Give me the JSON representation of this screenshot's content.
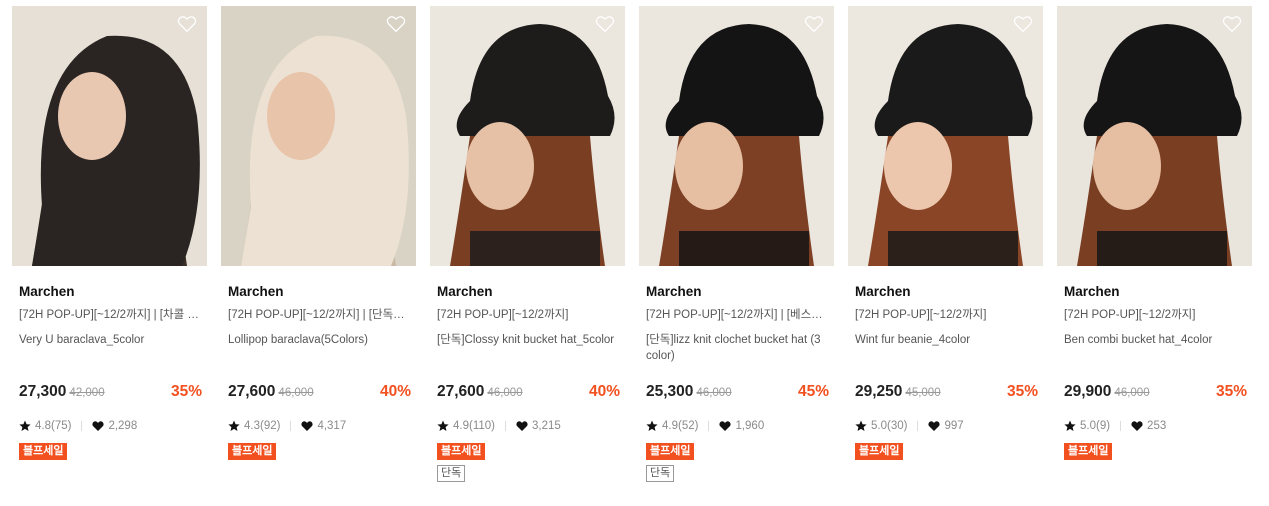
{
  "products": [
    {
      "brand": "Marchen",
      "promo": "[72H POP-UP][~12/2까지] | [차콜 단...",
      "name": "Very U baraclava_5color",
      "price": "27,300",
      "original": "42,000",
      "discount": "35%",
      "rating": "4.8(75)",
      "likes": "2,298",
      "badge": "블프세일",
      "extra_badge": "",
      "img": {
        "bg": "#e6e0d6",
        "hood": "#2a2522",
        "face": "#e9c8b2",
        "hair": "#3a2d26"
      }
    },
    {
      "brand": "Marchen",
      "promo": "[72H POP-UP][~12/2까지] | [단독뉴...",
      "name": "Lollipop baraclava(5Colors)",
      "price": "27,600",
      "original": "46,000",
      "discount": "40%",
      "rating": "4.3(92)",
      "likes": "4,317",
      "badge": "블프세일",
      "extra_badge": "",
      "img": {
        "bg": "#d9d3c6",
        "hood": "#ece1d2",
        "face": "#e8c4ab",
        "hair": "#c9b9a4"
      }
    },
    {
      "brand": "Marchen",
      "promo": "[72H POP-UP][~12/2까지]",
      "name": "[단독]Clossy knit bucket hat_5color",
      "price": "27,600",
      "original": "46,000",
      "discount": "40%",
      "rating": "4.9(110)",
      "likes": "3,215",
      "badge": "블프세일",
      "extra_badge": "단독",
      "img": {
        "bg": "#ebe6de",
        "hood": "#1e1c1b",
        "face": "#e7c1a6",
        "hair": "#7a3e22"
      }
    },
    {
      "brand": "Marchen",
      "promo": "[72H POP-UP][~12/2까지] | [베스트...",
      "name": "[단독]lizz knit clochet bucket hat (3 color)",
      "price": "25,300",
      "original": "46,000",
      "discount": "45%",
      "rating": "4.9(52)",
      "likes": "1,960",
      "badge": "블프세일",
      "extra_badge": "단독",
      "img": {
        "bg": "#ebe6de",
        "hood": "#151414",
        "face": "#e6bfa3",
        "hair": "#7d4024"
      }
    },
    {
      "brand": "Marchen",
      "promo": "[72H POP-UP][~12/2까지]",
      "name": "Wint fur beanie_4color",
      "price": "29,250",
      "original": "45,000",
      "discount": "35%",
      "rating": "5.0(30)",
      "likes": "997",
      "badge": "블프세일",
      "extra_badge": "",
      "img": {
        "bg": "#ece7df",
        "hood": "#1b1a1a",
        "face": "#ecc7ad",
        "hair": "#8a4526"
      }
    },
    {
      "brand": "Marchen",
      "promo": "[72H POP-UP][~12/2까지]",
      "name": "Ben combi bucket hat_4color",
      "price": "29,900",
      "original": "46,000",
      "discount": "35%",
      "rating": "5.0(9)",
      "likes": "253",
      "badge": "블프세일",
      "extra_badge": "",
      "img": {
        "bg": "#e9e4dc",
        "hood": "#161515",
        "face": "#e6bfa3",
        "hair": "#7a3e22"
      }
    }
  ]
}
